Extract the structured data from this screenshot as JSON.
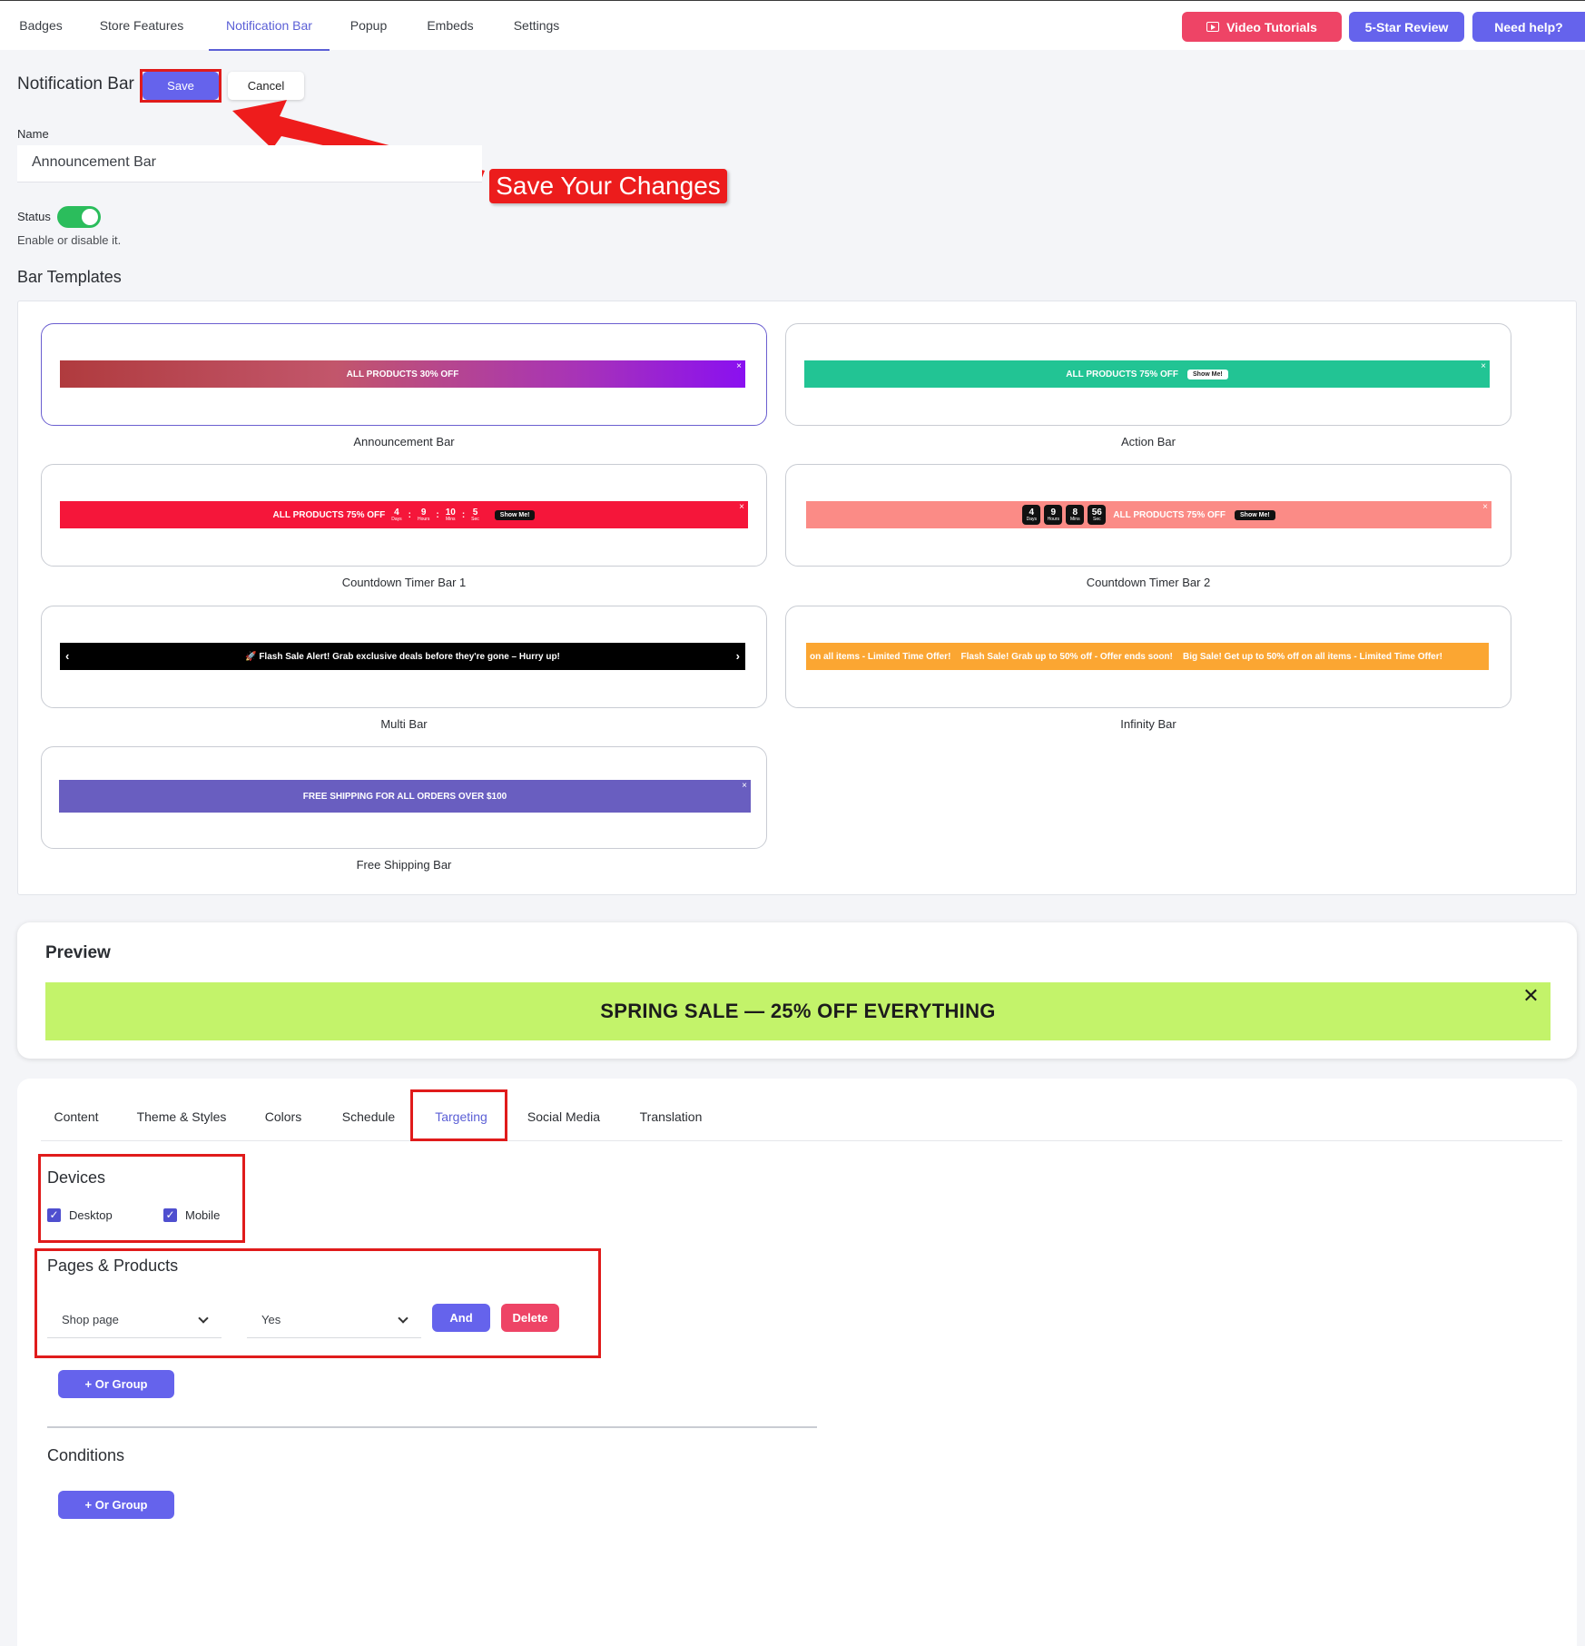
{
  "nav": {
    "tabs": [
      "Badges",
      "Store Features",
      "Notification Bar",
      "Popup",
      "Embeds",
      "Settings"
    ],
    "active_tab": "Notification Bar",
    "video_tutorials": "Video Tutorials",
    "five_star_review": "5-Star Review",
    "need_help": "Need help?"
  },
  "header": {
    "title": "Notification Bar",
    "save_label": "Save",
    "cancel_label": "Cancel"
  },
  "form": {
    "name_label": "Name",
    "name_value": "Announcement Bar",
    "status_label": "Status",
    "status_on": true,
    "status_help": "Enable or disable it."
  },
  "annotation": {
    "callout_text": "Save Your Changes"
  },
  "templates": {
    "heading": "Bar Templates",
    "items": [
      {
        "label": "Announcement Bar",
        "bar_text": "ALL PRODUCTS 30% OFF",
        "selected": true
      },
      {
        "label": "Action Bar",
        "bar_text": "ALL PRODUCTS 75% OFF",
        "button": "Show Me!"
      },
      {
        "label": "Countdown Timer Bar 1",
        "bar_text": "ALL PRODUCTS 75% OFF",
        "button": "Show Me!",
        "timer": [
          {
            "v": "4",
            "u": "Days"
          },
          {
            "v": "9",
            "u": "Hours"
          },
          {
            "v": "10",
            "u": "Mins"
          },
          {
            "v": "5",
            "u": "Sec"
          }
        ]
      },
      {
        "label": "Countdown Timer Bar 2",
        "bar_text": "ALL PRODUCTS 75% OFF",
        "button": "Show Me!",
        "timer": [
          {
            "v": "4",
            "u": "Days"
          },
          {
            "v": "9",
            "u": "Hours"
          },
          {
            "v": "8",
            "u": "Mins"
          },
          {
            "v": "56",
            "u": "Sec"
          }
        ]
      },
      {
        "label": "Multi Bar",
        "bar_text": "🚀 Flash Sale Alert! Grab exclusive deals before they're gone – Hurry up!"
      },
      {
        "label": "Infinity Bar",
        "bar_text": "on all items - Limited Time Offer!    Flash Sale! Grab up to 50% off - Offer ends soon!    Big Sale! Get up to 50% off on all items - Limited Time Offer!"
      },
      {
        "label": "Free Shipping Bar",
        "bar_text": "FREE SHIPPING FOR ALL ORDERS OVER $100"
      }
    ]
  },
  "preview": {
    "heading": "Preview",
    "bar_text": "SPRING SALE — 25% OFF EVERYTHING",
    "bar_color": "#c3f36a"
  },
  "settings_tabs": {
    "tabs": [
      "Content",
      "Theme & Styles",
      "Colors",
      "Schedule",
      "Targeting",
      "Social Media",
      "Translation"
    ],
    "active": "Targeting"
  },
  "targeting": {
    "devices_heading": "Devices",
    "desktop_label": "Desktop",
    "desktop_checked": true,
    "mobile_label": "Mobile",
    "mobile_checked": true,
    "pages_heading": "Pages & Products",
    "page_select": "Shop page",
    "condition_select": "Yes",
    "and_label": "And",
    "delete_label": "Delete",
    "or_group_label": "+ Or Group",
    "conditions_heading": "Conditions",
    "conditions_or_group_label": "+ Or Group"
  },
  "colors": {
    "accent": "#6563ec",
    "danger": "#ee4466",
    "annotation_red": "#e01b1b",
    "toggle_on": "#2bbd5c"
  }
}
